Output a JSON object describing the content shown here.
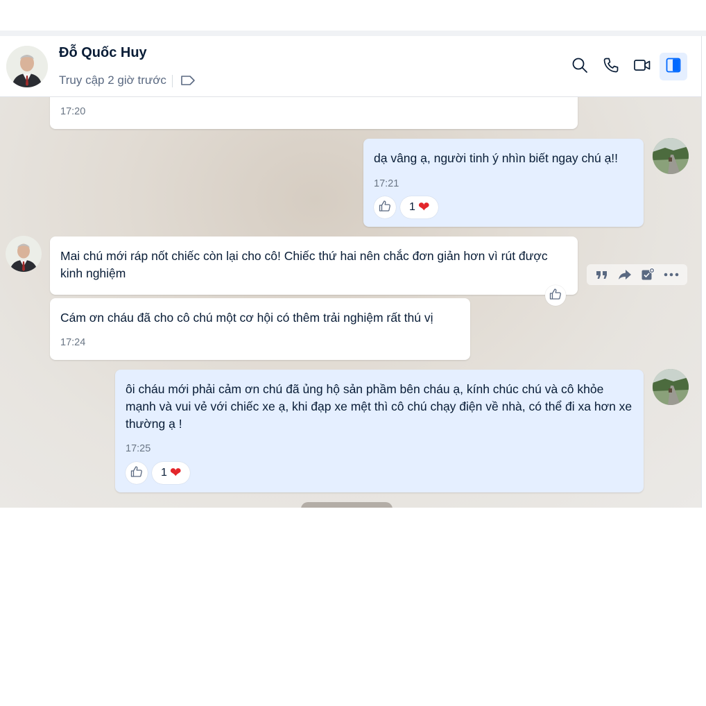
{
  "header": {
    "contact_name": "Đỗ Quốc Huy",
    "status": "Truy cập 2 giờ trước",
    "icons": [
      "search-icon",
      "phone-icon",
      "video-call-icon",
      "sidebar-toggle-icon",
      "tag-icon"
    ]
  },
  "messages": [
    {
      "direction": "incoming",
      "text": "",
      "time": "17:20"
    },
    {
      "direction": "outgoing",
      "text": "dạ vâng ạ, người tinh ý nhìn biết ngay chú ạ!!",
      "time": "17:21",
      "reaction": {
        "count": "1",
        "emoji": "❤️"
      }
    },
    {
      "direction": "incoming",
      "text": "Mai chú mới ráp nốt chiếc còn lại cho cô! Chiếc thứ hai nên chắc đơn giản hơn vì rút được kinh nghiệm",
      "time": ""
    },
    {
      "direction": "incoming",
      "text": "Cám ơn cháu đã cho cô chú một cơ hội có thêm trải nghiệm rất thú vị",
      "time": "17:24"
    },
    {
      "direction": "outgoing",
      "text": "ôi cháu mới phải cảm ơn chú đã ủng hộ sản phầm bên cháu ạ, kính chúc chú và cô khỏe mạnh và vui vẻ với chiếc xe ạ, khi đạp xe mệt thì cô chú chạy điện về nhà, có thể đi xa hơn xe thường ạ !",
      "time": "17:25",
      "reaction": {
        "count": "1",
        "emoji": "❤️"
      }
    }
  ],
  "message_toolbar": {
    "icons": [
      "quote-icon",
      "forward-icon",
      "add-todo-icon",
      "more-icon"
    ]
  },
  "colors": {
    "incoming_bubble": "#ffffff",
    "outgoing_bubble": "#e5efff",
    "accent": "#0068ff",
    "heart": "#e3262b"
  }
}
